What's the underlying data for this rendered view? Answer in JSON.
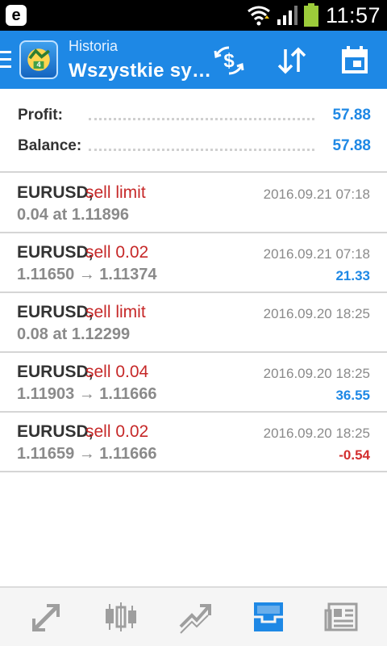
{
  "status_bar": {
    "app_badge": "e",
    "time": "11:57"
  },
  "app_bar": {
    "subtitle": "Historia",
    "title": "Wszystkie sy…",
    "icons": [
      "menu-icon",
      "app-logo-icon",
      "currency-exchange-icon",
      "sort-icon",
      "calendar-icon"
    ]
  },
  "summary": {
    "profit_label": "Profit:",
    "profit_value": "57.88",
    "balance_label": "Balance:",
    "balance_value": "57.88"
  },
  "trades": [
    {
      "symbol": "EURUSD,",
      "type": "sell limit",
      "date": "2016.09.21 07:18",
      "detail": "0.04 at 1.11896",
      "profit": ""
    },
    {
      "symbol": "EURUSD,",
      "type": "sell 0.02",
      "date": "2016.09.21 07:18",
      "detail": "1.11650 → 1.11374",
      "profit": "21.33"
    },
    {
      "symbol": "EURUSD,",
      "type": "sell limit",
      "date": "2016.09.20 18:25",
      "detail": "0.08 at 1.12299",
      "profit": ""
    },
    {
      "symbol": "EURUSD,",
      "type": "sell 0.04",
      "date": "2016.09.20 18:25",
      "detail": "1.11903 → 1.11666",
      "profit": "36.55"
    },
    {
      "symbol": "EURUSD,",
      "type": "sell 0.02",
      "date": "2016.09.20 18:25",
      "detail": "1.11659 → 1.11666",
      "profit": "-0.54"
    }
  ],
  "colors": {
    "accent": "#1e88e5",
    "negative": "#d32f2f",
    "sell": "#c62828",
    "muted": "#8a8a8a"
  },
  "bottom_nav": {
    "items": [
      "quotes-icon",
      "chart-icon",
      "trade-icon",
      "history-icon",
      "news-icon"
    ],
    "active": "history-icon"
  }
}
